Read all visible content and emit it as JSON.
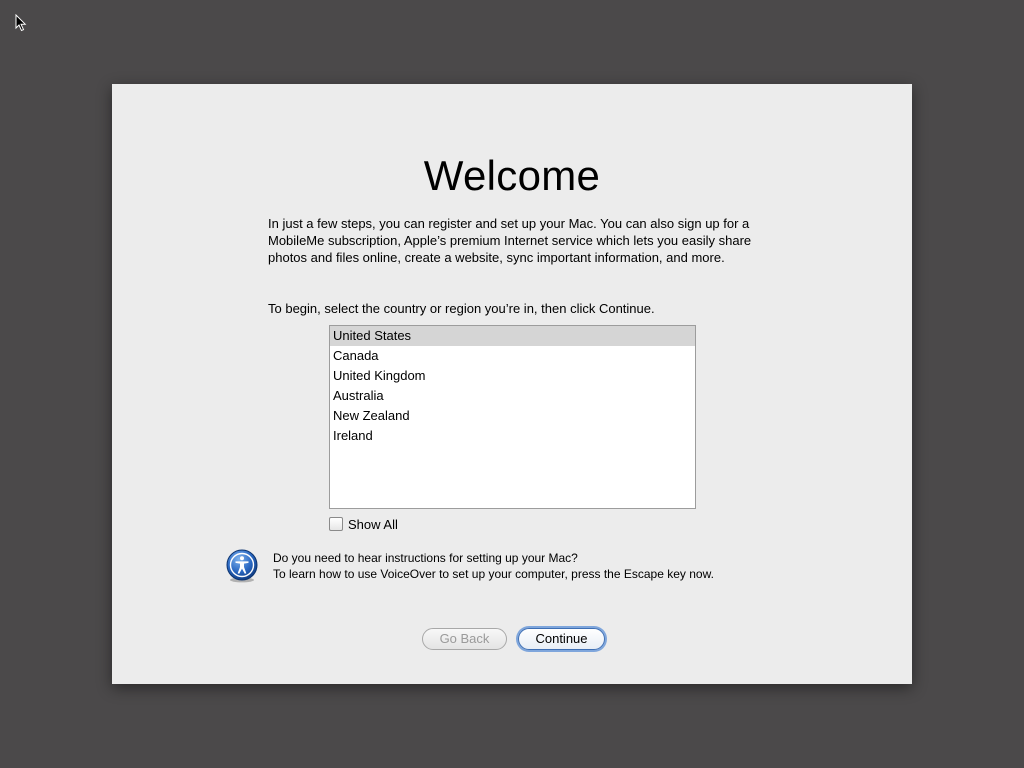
{
  "title": "Welcome",
  "intro_text": "In just a few steps, you can register and set up your Mac. You can also sign up for a MobileMe subscription, Apple’s premium Internet service which lets you easily share photos and files online, create a website, sync important information, and more.",
  "prompt_text": "To begin, select the country or region you’re in, then click Continue.",
  "countries": [
    "United States",
    "Canada",
    "United Kingdom",
    "Australia",
    "New Zealand",
    "Ireland"
  ],
  "selected_country": "United States",
  "show_all": {
    "label": "Show All",
    "checked": false
  },
  "voiceover": {
    "icon": "accessibility-icon",
    "line1": "Do you need to hear instructions for setting up your Mac?",
    "line2": "To learn how to use VoiceOver to set up your computer, press the Escape key now."
  },
  "buttons": {
    "go_back": "Go Back",
    "continue": "Continue"
  },
  "colors": {
    "desktop": "#4b494a",
    "panel": "#ececec",
    "selection": "#d5d5d5",
    "default_button_ring": "#7fa6dc"
  }
}
